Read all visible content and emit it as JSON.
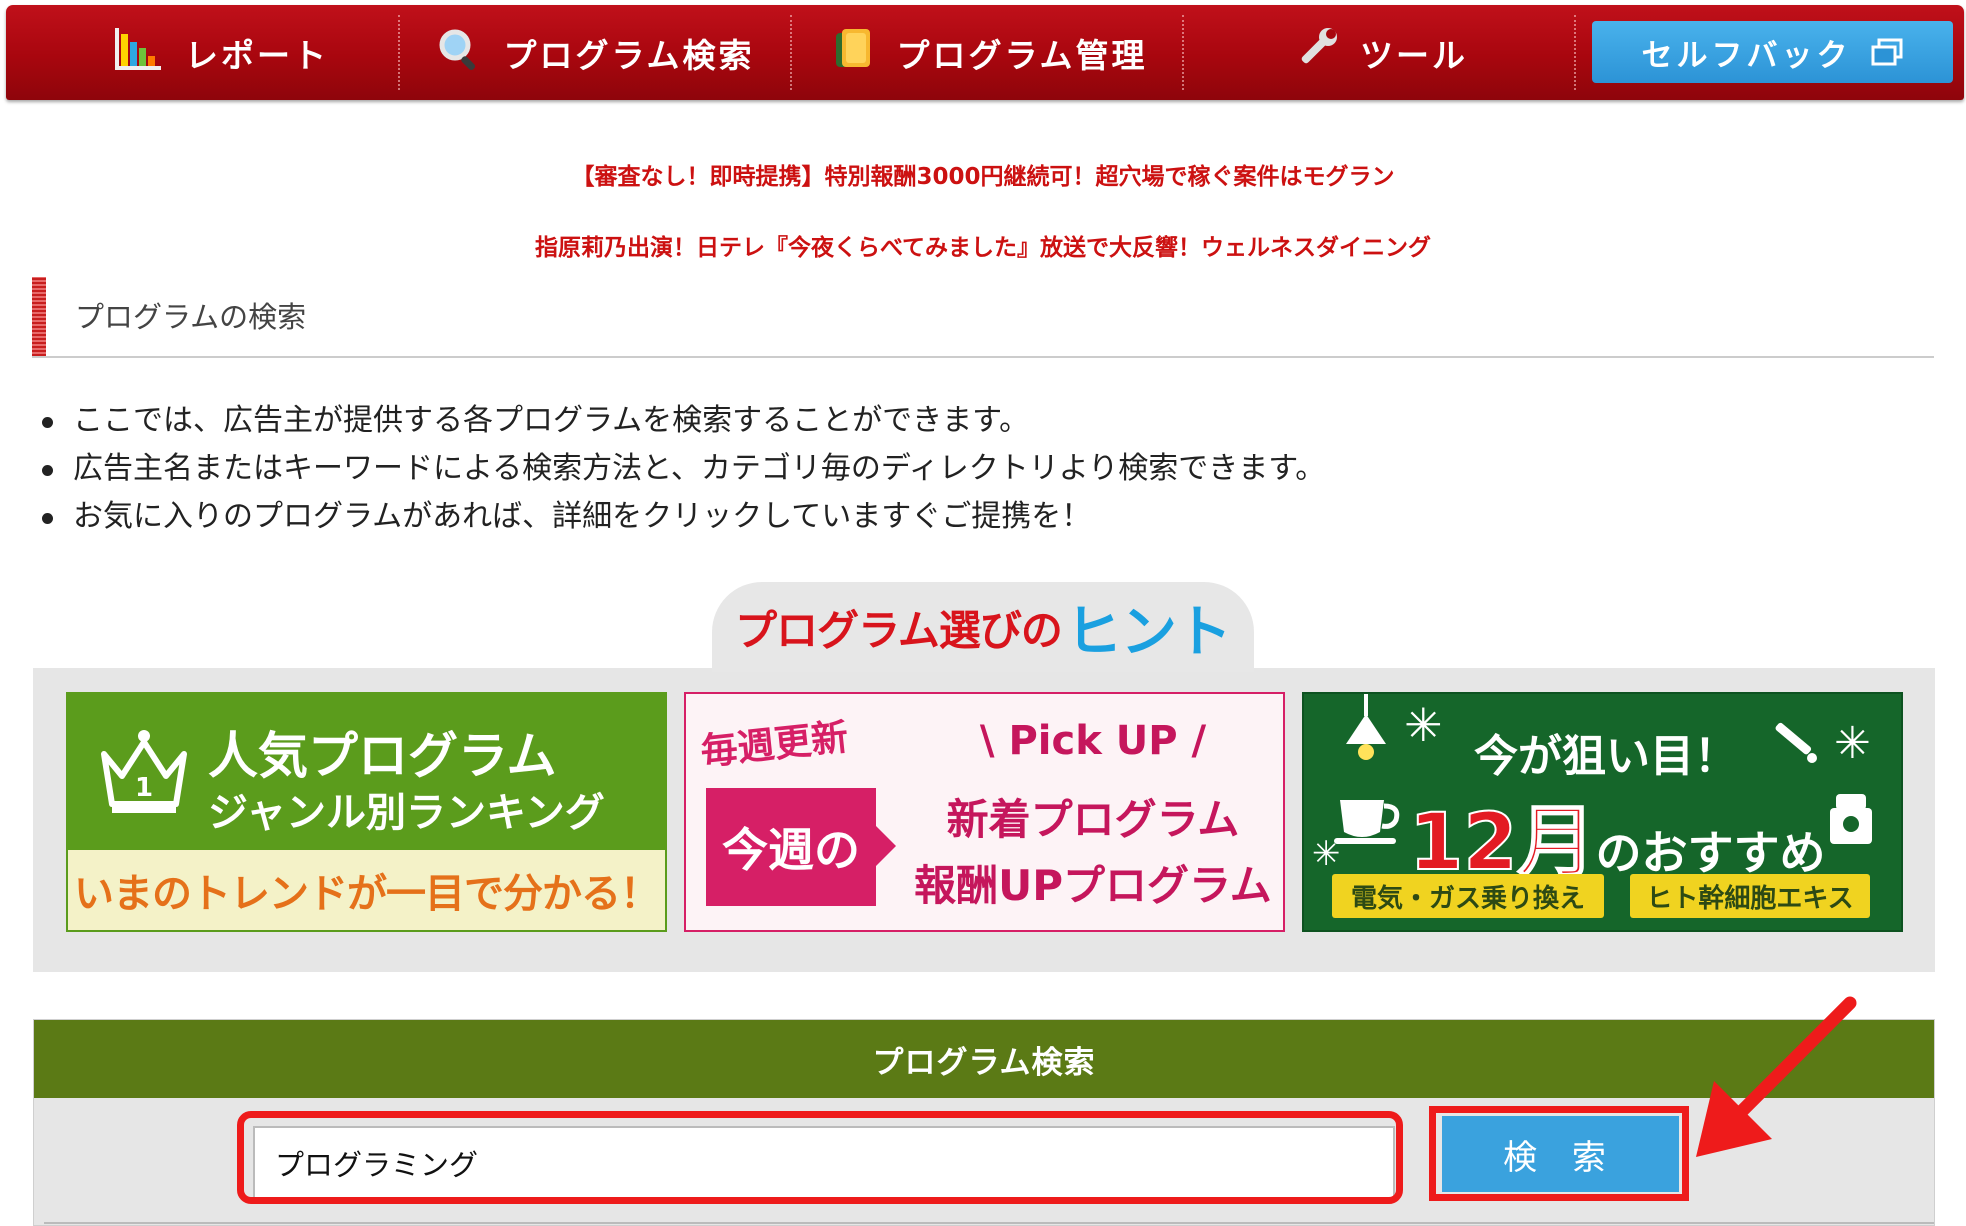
{
  "nav": {
    "items": [
      {
        "label": "レポート",
        "icon": "bar-chart-icon"
      },
      {
        "label": "プログラム検索",
        "icon": "magnifier-icon"
      },
      {
        "label": "プログラム管理",
        "icon": "folder-icon"
      },
      {
        "label": "ツール",
        "icon": "wrench-icon"
      }
    ],
    "selfback": {
      "label": "セルフバック",
      "icon": "window-icon"
    }
  },
  "promos": [
    "【審査なし！即時提携】特別報酬3000円継続可！超穴場で稼ぐ案件はモグラン",
    "指原莉乃出演！日テレ『今夜くらべてみました』放送で大反響！ウェルネスダイニング"
  ],
  "section": {
    "title": "プログラムの検索"
  },
  "bullets": [
    "ここでは、広告主が提供する各プログラムを検索することができます。",
    "広告主名またはキーワードによる検索方法と、カテゴリ毎のディレクトリより検索できます。",
    "お気に入りのプログラムがあれば、詳細をクリックしていますぐご提携を！"
  ],
  "hint": {
    "prefix": "プログラム選びの",
    "word": "ヒント"
  },
  "banners": {
    "ranking": {
      "line1": "人気プログラム",
      "line2": "ジャンル別ランキング",
      "tagline": "いまのトレンドが一目で分かる！",
      "badge": "1"
    },
    "weekly": {
      "weekly": "毎週更新",
      "thisweek": "今週の",
      "pick": "\\ Pick UP /",
      "new": "新着プログラム",
      "up": "報酬UPプログラム"
    },
    "december": {
      "now": "今が狙い目！",
      "month_num": "12月",
      "month_suffix": "のおすすめ",
      "tag1": "電気・ガス乗り換え",
      "tag2": "ヒト幹細胞エキス"
    }
  },
  "search": {
    "header": "プログラム検索",
    "value": "プログラミング",
    "button": "検 索"
  },
  "colors": {
    "nav_red": "#a8060e",
    "selfback_blue": "#2c93d6",
    "promo_red": "#cc1111",
    "search_header_green": "#5b7a15",
    "search_button_blue": "#3aa2de",
    "annotation_red": "#ee1b1b"
  }
}
